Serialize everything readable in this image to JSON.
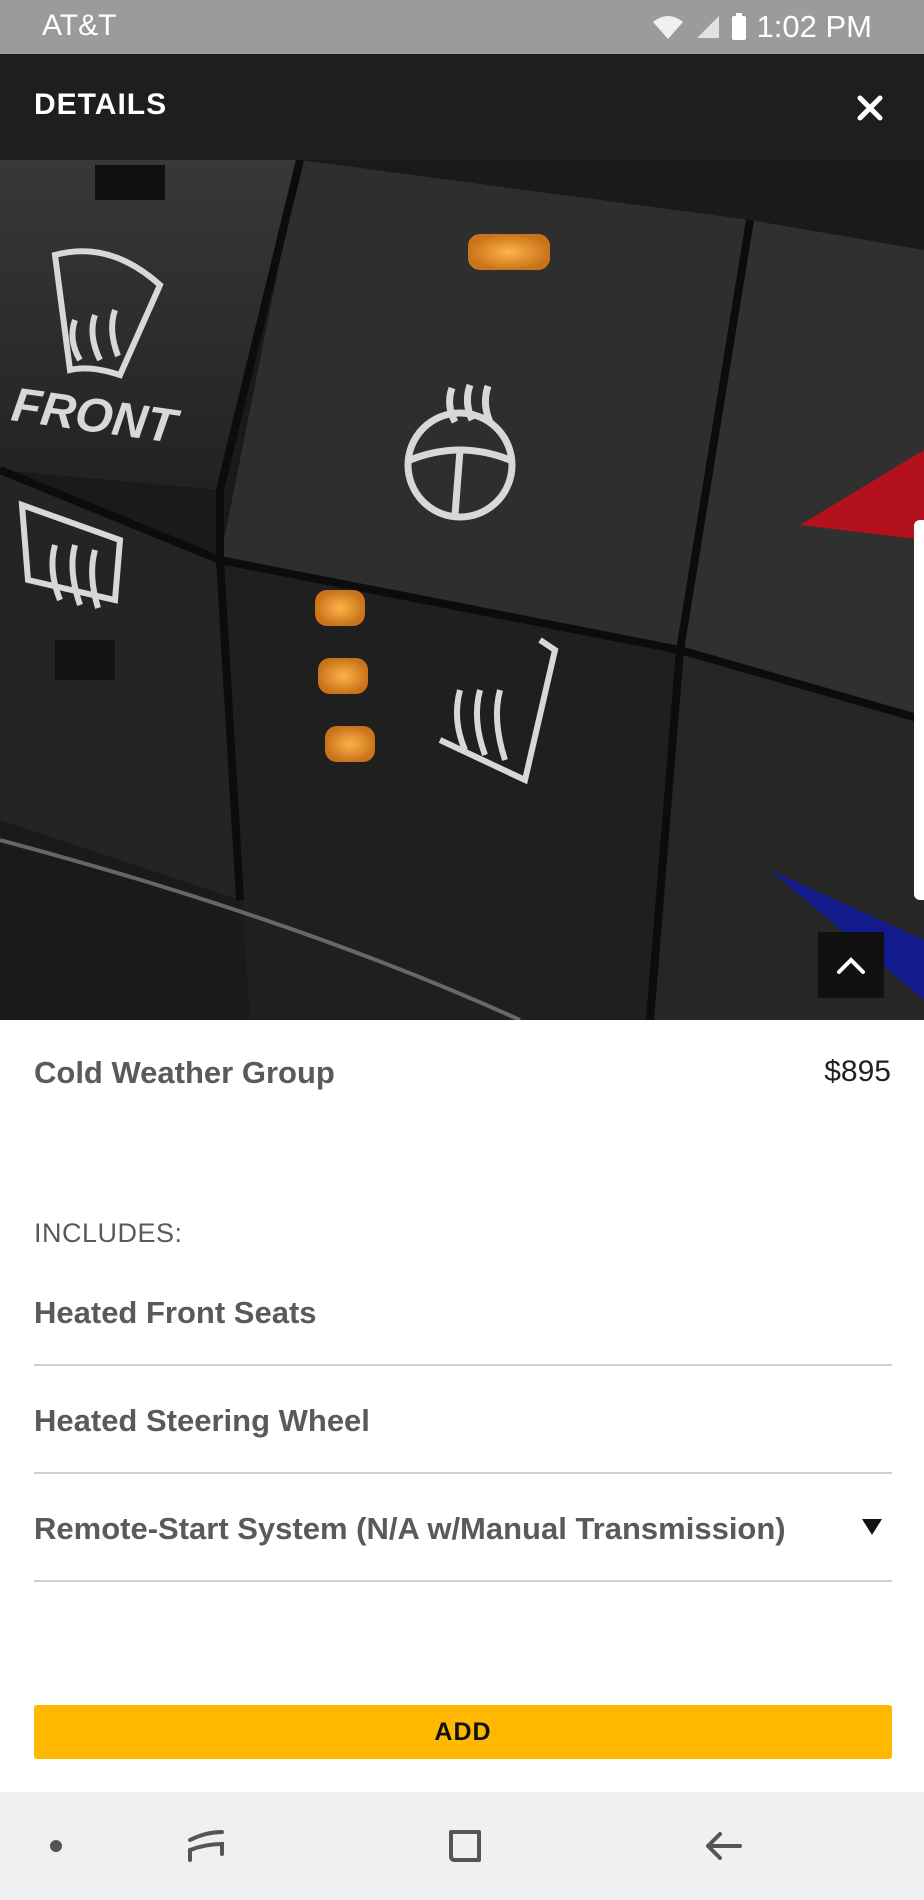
{
  "status_bar": {
    "carrier": "AT&T",
    "time": "1:02 PM",
    "icons": [
      "wifi-icon",
      "signal-icon",
      "battery-icon"
    ]
  },
  "header": {
    "title": "DETAILS",
    "close_icon": "close-icon"
  },
  "hero": {
    "image_description_icon": "hero-image",
    "button_labels": [
      "FRONT"
    ],
    "scroll_top_icon": "chevron-up-icon",
    "indicator_color": "#f39a26"
  },
  "product": {
    "name": "Cold Weather Group",
    "price": "$895"
  },
  "includes": {
    "label": "INCLUDES:",
    "items": [
      {
        "label": "Heated Front Seats"
      },
      {
        "label": "Heated Steering Wheel"
      },
      {
        "label": "Remote-Start System (N/A w/Manual Transmission)",
        "expandable": true
      }
    ]
  },
  "actions": {
    "add_label": "ADD",
    "accent_color": "#ffb800"
  },
  "nav_bar": {
    "items": [
      "dot-icon",
      "recent-apps-icon",
      "home-icon",
      "back-icon"
    ]
  }
}
